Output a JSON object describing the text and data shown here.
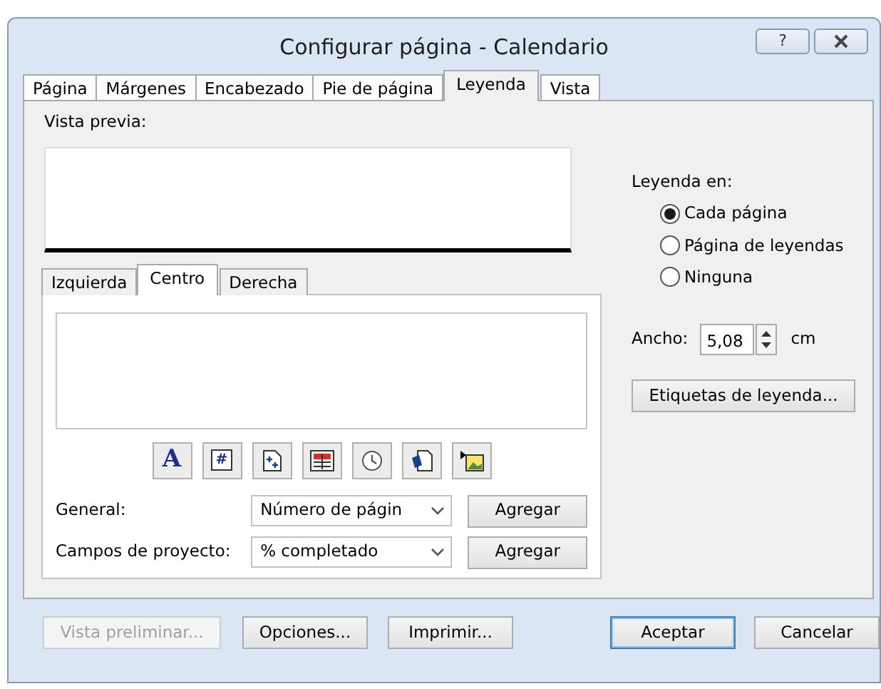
{
  "window": {
    "title": "Configurar página - Calendario",
    "help_button": "?"
  },
  "tabs": [
    {
      "label": "Página",
      "selected": false
    },
    {
      "label": "Márgenes",
      "selected": false
    },
    {
      "label": "Encabezado",
      "selected": false
    },
    {
      "label": "Pie de página",
      "selected": false
    },
    {
      "label": "Leyenda",
      "selected": true
    },
    {
      "label": "Vista",
      "selected": false
    }
  ],
  "preview": {
    "label": "Vista previa:"
  },
  "section_tabs": [
    {
      "label": "Izquierda",
      "selected": false
    },
    {
      "label": "Centro",
      "selected": true
    },
    {
      "label": "Derecha",
      "selected": false
    }
  ],
  "toolbar": [
    {
      "kind": "font",
      "glyph": "A"
    },
    {
      "kind": "page-number",
      "glyph": "#"
    },
    {
      "kind": "page-count"
    },
    {
      "kind": "date"
    },
    {
      "kind": "time"
    },
    {
      "kind": "file"
    },
    {
      "kind": "picture"
    }
  ],
  "fields": [
    {
      "label": "General:",
      "value": "Número de págin",
      "button": "Agregar"
    },
    {
      "label": "Campos de proyecto:",
      "value": "% completado",
      "button": "Agregar"
    }
  ],
  "legend_on": {
    "label": "Leyenda en:",
    "options": [
      {
        "label": "Cada página",
        "selected": true
      },
      {
        "label": "Página de leyendas",
        "selected": false
      },
      {
        "label": "Ninguna",
        "selected": false
      }
    ]
  },
  "width": {
    "label": "Ancho:",
    "value": "5,08",
    "unit": "cm"
  },
  "legend_labels_button": "Etiquetas de leyenda...",
  "footer_buttons": [
    {
      "label": "Vista preliminar...",
      "disabled": true,
      "default": false
    },
    {
      "label": "Opciones...",
      "disabled": false,
      "default": false
    },
    {
      "label": "Imprimir...",
      "disabled": false,
      "default": false
    },
    {
      "label": "Aceptar",
      "disabled": false,
      "default": true
    },
    {
      "label": "Cancelar",
      "disabled": false,
      "default": false
    }
  ]
}
